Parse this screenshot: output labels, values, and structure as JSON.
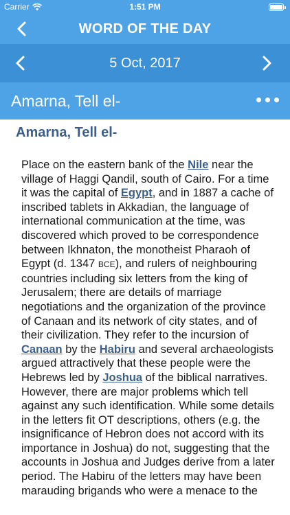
{
  "status_bar": {
    "carrier": "Carrier",
    "time": "1:51 PM"
  },
  "nav": {
    "title": "WORD OF THE DAY"
  },
  "date_bar": {
    "date": "5 Oct, 2017"
  },
  "entry_header": {
    "headword": "Amarna, Tell el-"
  },
  "entry": {
    "title": "Amarna, Tell el-",
    "p1": "Place on the eastern bank of the ",
    "link_nile": "Nile",
    "p2": " near the village of Haggi Qandil, south of Cairo. For a time it was the capital of ",
    "link_egypt": "Egypt",
    "p3": ", and in 1887 a cache of inscribed tablets in Akkadian, the language of international communication at the time, was discovered which proved to be correspondence between Ikhnaton, the monotheist Pharaoh of Egypt (d. 1347 ",
    "era": "BCE",
    "p4": "), and rulers of neighbouring countries including six letters from the king of Jerusalem; there are details of marriage negotiations and the organization of the province of Canaan and its network of city states, and of their civilization. They refer to the incursion of ",
    "link_canaan": "Canaan",
    "p5": " by the ",
    "link_habiru": "Habiru",
    "p6": " and several archaeologists argued attractively that these people were the Hebrews led by ",
    "link_joshua": "Joshua",
    "p7": " of the biblical narratives. However, there are major problems which tell against any such identification. While some details in the letters fit OT descriptions, others (e.g. the insignificance of Hebron does not accord with its importance in Joshua) do not, suggesting that the accounts in Joshua and Judges derive from a later period. The Habiru of the letters may have been marauding brigands who were a menace to the"
  }
}
